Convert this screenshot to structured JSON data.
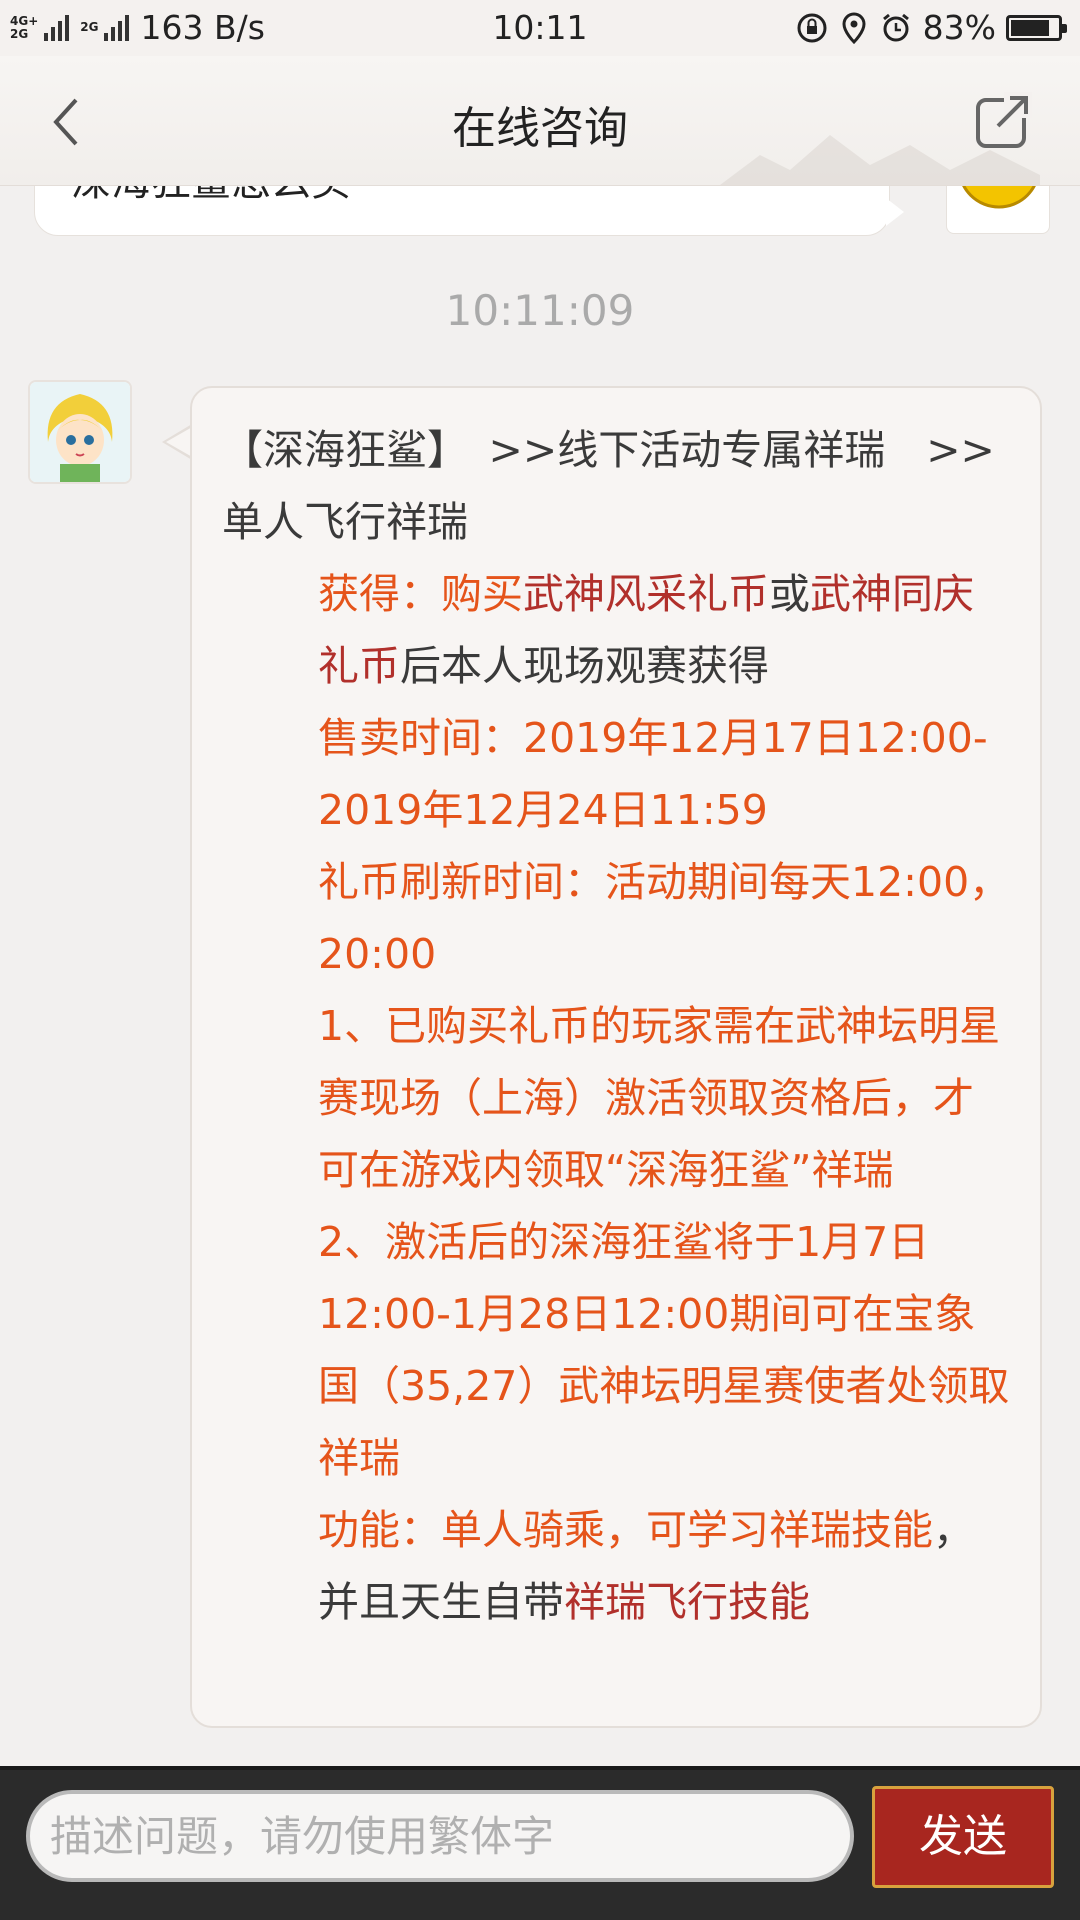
{
  "status_bar": {
    "signal_top": "4G+",
    "signal_bottom": "2G",
    "signal_extra": "2G",
    "speed": "163 B/s",
    "time": "10:11",
    "battery": "83%",
    "battery_level": 0.83
  },
  "header": {
    "title": "在线咨询"
  },
  "chat": {
    "previous_message": "深海狂鲨怎么买",
    "timestamp": "10:11:09",
    "reply": {
      "line1_title": "【深海狂鲨】",
      "line1_rest": "　>>线下活动专属祥瑞　>>单人飞行祥瑞",
      "obtain_label": "获得：",
      "obtain_buy": "购买",
      "obtain_coin1": "武神风采礼币",
      "obtain_or": "或",
      "obtain_coin2": "武神同庆礼币",
      "obtain_rest": "后本人现场观赛获得",
      "sale_time": "售卖时间：2019年12月17日12:00-2019年12月24日11:59",
      "refresh_time": "礼币刷新时间：活动期间每天12:00，20:00",
      "note1": "1、已购买礼币的玩家需在武神坛明星赛现场（上海）激活领取资格后，才可在游戏内领取“深海狂鲨”祥瑞",
      "note2": "2、激活后的深海狂鲨将于1月7日12:00-1月28日12:00期间可在宝象国（35,27）武神坛明星赛使者处领取祥瑞",
      "func_label": "功能：",
      "func_a": "单人骑乘，可学习祥瑞技能",
      "func_b": "，并且天生自带",
      "func_c": "祥瑞飞行技能"
    }
  },
  "input_bar": {
    "placeholder": "描述问题，请勿使用繁体字",
    "send_label": "发送"
  }
}
